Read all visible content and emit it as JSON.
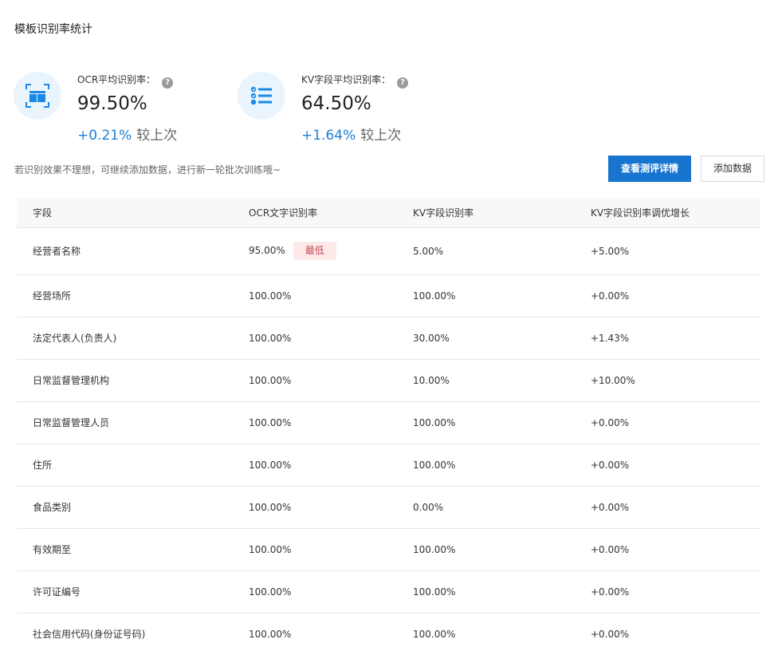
{
  "page": {
    "title": "模板识别率统计"
  },
  "stats": [
    {
      "label": "OCR平均识别率：",
      "value": "99.50%",
      "delta": "+0.21%",
      "delta_text": "较上次",
      "icon": "layout-icon",
      "help": "?"
    },
    {
      "label": "KV字段平均识别率：",
      "value": "64.50%",
      "delta": "+1.64%",
      "delta_text": "较上次",
      "icon": "list-check-icon",
      "help": "?"
    }
  ],
  "hint": "若识别效果不理想，可继续添加数据，进行新一轮批次训练哦~",
  "actions": {
    "view_details": "查看测评详情",
    "add_data": "添加数据"
  },
  "table": {
    "columns": [
      "字段",
      "OCR文字识别率",
      "KV字段识别率",
      "KV字段识别率调优增长"
    ],
    "rows": [
      {
        "field": "经营者名称",
        "ocr": "95.00%",
        "badge": "最低",
        "kv": "5.00%",
        "growth": "+5.00%"
      },
      {
        "field": "经营场所",
        "ocr": "100.00%",
        "kv": "100.00%",
        "growth": "+0.00%"
      },
      {
        "field": "法定代表人(负责人)",
        "ocr": "100.00%",
        "kv": "30.00%",
        "growth": "+1.43%"
      },
      {
        "field": "日常监督管理机构",
        "ocr": "100.00%",
        "kv": "10.00%",
        "growth": "+10.00%"
      },
      {
        "field": "日常监督管理人员",
        "ocr": "100.00%",
        "kv": "100.00%",
        "growth": "+0.00%"
      },
      {
        "field": "住所",
        "ocr": "100.00%",
        "kv": "100.00%",
        "growth": "+0.00%"
      },
      {
        "field": "食品类别",
        "ocr": "100.00%",
        "kv": "0.00%",
        "growth": "+0.00%"
      },
      {
        "field": "有效期至",
        "ocr": "100.00%",
        "kv": "100.00%",
        "growth": "+0.00%"
      },
      {
        "field": "许可证编号",
        "ocr": "100.00%",
        "kv": "100.00%",
        "growth": "+0.00%"
      },
      {
        "field": "社会信用代码(身份证号码)",
        "ocr": "100.00%",
        "kv": "100.00%",
        "growth": "+0.00%"
      }
    ]
  },
  "colors": {
    "accent": "#1775cf",
    "delta_blue": "#1a7fd6",
    "increase_red": "#e5143f",
    "badge_bg": "#fde9ea",
    "icon_bg": "#eaf4fd"
  }
}
